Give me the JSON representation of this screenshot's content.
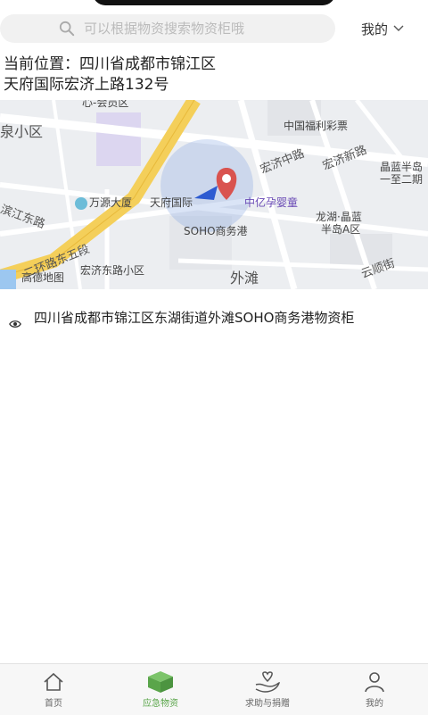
{
  "search": {
    "placeholder": "可以根据物资搜索物资柜哦"
  },
  "header": {
    "user_menu_label": "我的"
  },
  "location": {
    "line1": "当前位置：四川省成都市锦江区",
    "line2": "天府国际宏济上路132号"
  },
  "map": {
    "labels": {
      "top_center": "心-会员区",
      "left_area": "泉小区",
      "fuli": "中国福利彩票",
      "hongji_zhong": "宏济中路",
      "hongji_xin": "宏济新路",
      "jinglan_1": "晶蓝半岛",
      "jinglan_2": "一至二期",
      "jiang_road": "滨江东路",
      "wanyuan": "万源大厦",
      "tianfu": "天府国际",
      "zhongyi": "中亿孕婴童",
      "longhu_1": "龙湖·晶蓝",
      "longhu_2": "半岛A区",
      "soho": "SOHO商务港",
      "east5": "二环路东五段",
      "hongji_east": "宏济东路小区",
      "waitan": "外滩",
      "yunshun": "云顺街",
      "gaode": "高德地图"
    }
  },
  "address": {
    "text": "四川省成都市锦江区东湖街道外滩SOHO商务港物资柜"
  },
  "tabbar": {
    "tabs": [
      {
        "label": "首页",
        "icon": "home-icon"
      },
      {
        "label": "应急物资",
        "icon": "box-icon"
      },
      {
        "label": "求助与捐赠",
        "icon": "hand-heart-icon"
      },
      {
        "label": "我的",
        "icon": "user-icon"
      }
    ],
    "active_color": "#5aa54a"
  }
}
